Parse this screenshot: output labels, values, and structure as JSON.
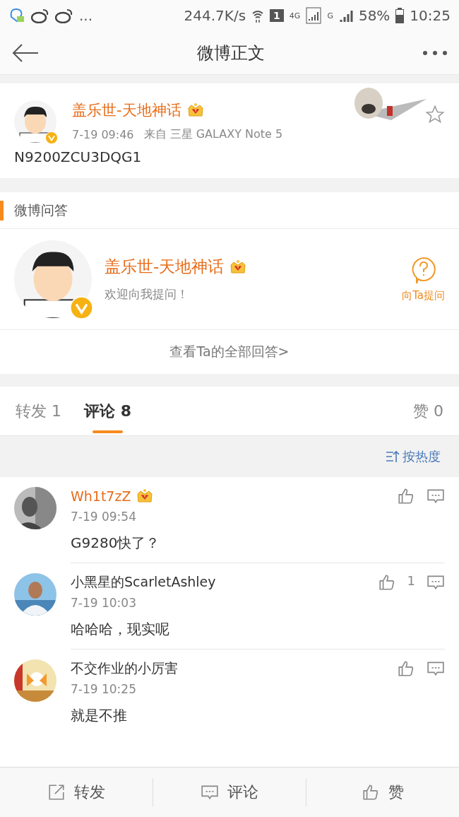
{
  "status_bar": {
    "more": "...",
    "speed": "244.7K/s",
    "sim": "1",
    "network_4g": "4G",
    "network_g": "G",
    "battery": "58%",
    "time": "10:25"
  },
  "header": {
    "title": "微博正文"
  },
  "post": {
    "author": "盖乐世-天地神话",
    "time": "7-19 09:46",
    "source": "来自 三星 GALAXY Note 5",
    "text": "N9200ZCU3DQG1",
    "favorited": false
  },
  "qa": {
    "title": "微博问答",
    "author": "盖乐世-天地神话",
    "greeting": "欢迎向我提问！",
    "ask_label": "向Ta提问",
    "view_all": "查看Ta的全部回答>"
  },
  "tabs": [
    {
      "label": "转发",
      "count": "1",
      "selected": false
    },
    {
      "label": "评论",
      "count": "8",
      "selected": true
    }
  ],
  "likes": {
    "label": "赞",
    "count": "0"
  },
  "sort": {
    "label": "按热度"
  },
  "comments": [
    {
      "name": "Wh1t7zZ",
      "vip": true,
      "time": "7-19 09:54",
      "text": "G9280快了？"
    },
    {
      "name": "小黑星的ScarletAshley",
      "vip": false,
      "time": "7-19 10:03",
      "text": "哈哈哈，现实呢",
      "likes": "1"
    },
    {
      "name": "不交作业的小厉害",
      "vip": false,
      "time": "7-19 10:25",
      "text": "就是不推"
    }
  ],
  "bottom_bar": [
    {
      "kind": "share",
      "label": "转发"
    },
    {
      "kind": "comment",
      "label": "评论"
    },
    {
      "kind": "like",
      "label": "赞"
    }
  ]
}
